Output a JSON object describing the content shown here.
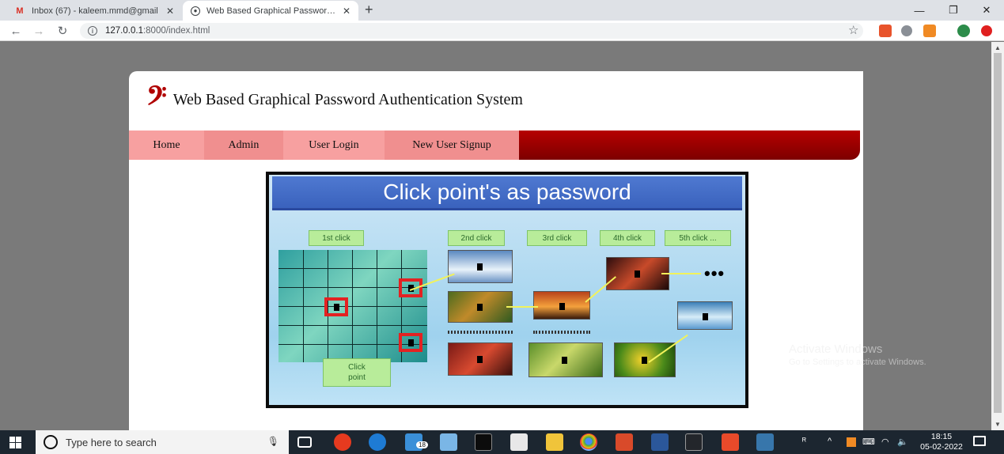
{
  "browser": {
    "tabs": [
      {
        "title": "Inbox (67) - kaleem.mmd@gmail",
        "favicon": "gmail-icon",
        "active": false
      },
      {
        "title": "Web Based Graphical Password A",
        "favicon": "globe-icon",
        "active": true
      }
    ],
    "new_tab": "+",
    "url_host": "127.0.0.1",
    "url_path": ":8000/index.html",
    "window_controls": {
      "minimize": "—",
      "restore": "❐",
      "close": "✕"
    }
  },
  "page": {
    "logo_glyph": "𝄢",
    "title": "Web Based Graphical Password Authentication System",
    "nav": [
      "Home",
      "Admin",
      "User Login",
      "New User Signup"
    ],
    "hero": {
      "banner": "Click point's as password",
      "clicks": [
        "1st click",
        "2nd click",
        "3rd click",
        "4th click",
        "5th click ..."
      ],
      "ellipsis": "•••",
      "click_point_label": "Click point"
    }
  },
  "watermark": {
    "line1": "Activate Windows",
    "line2": "Go to Settings to activate Windows."
  },
  "taskbar": {
    "search_placeholder": "Type here to search",
    "badge_count": "18",
    "time": "18:15",
    "date": "05-02-2022"
  },
  "colors": {
    "menu_bar": "#9a0000",
    "menu_tab_light": "#f7a0a0",
    "banner_blue": "#3f6ac8",
    "taskbar": "#1c2630"
  }
}
